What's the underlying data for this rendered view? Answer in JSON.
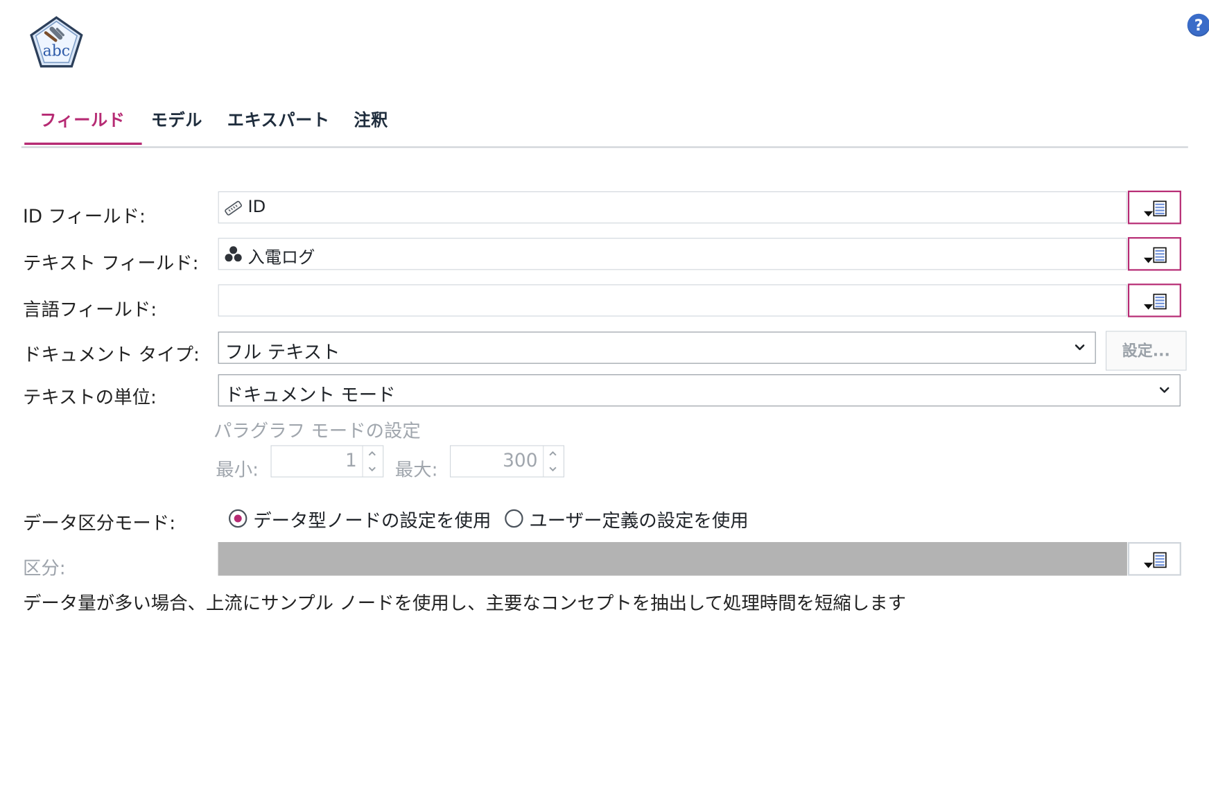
{
  "tabs": [
    {
      "label": "フィールド",
      "active": true
    },
    {
      "label": "モデル",
      "active": false
    },
    {
      "label": "エキスパート",
      "active": false
    },
    {
      "label": "注釈",
      "active": false
    }
  ],
  "window_controls": {
    "help": "?"
  },
  "form": {
    "id_field_label": "ID フィールド:",
    "id_field_value": "ID",
    "text_field_label": "テキスト フィールド:",
    "text_field_value": "入電ログ",
    "language_field_label": "言語フィールド:",
    "document_type_label": "ドキュメント タイプ:",
    "document_type_value": "フル テキスト",
    "settings_button": "設定...",
    "text_unit_label": "テキストの単位:",
    "text_unit_value": "ドキュメント モード",
    "paragraph_mode_title": "パラグラフ モードの設定",
    "min_label": "最小:",
    "min_value": "1",
    "max_label": "最大:",
    "max_value": "300",
    "partition_mode_label": "データ区分モード:",
    "partition_option_1": "データ型ノードの設定を使用",
    "partition_option_2": "ユーザー定義の設定を使用",
    "partition_label": "区分:",
    "note": "データ量が多い場合、上流にサンプル ノードを使用し、主要なコンセプトを抽出して処理時間を短縮します"
  },
  "colors": {
    "accent": "#b62a73",
    "help": "#3a6cc8",
    "disabled_fill": "#b3b3b3"
  },
  "icons": {
    "logo": "text-mining-node-icon",
    "id_field": "ruler-icon",
    "text_field": "triangle-dots-icon",
    "picker": "field-picker-icon"
  }
}
